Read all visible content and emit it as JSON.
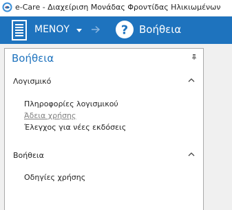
{
  "window": {
    "title": "e-Care - Διαχείριση Μονάδας Φροντίδας Ηλικιωμένων"
  },
  "toolbar": {
    "menu_label": "ΜΕΝΟΥ",
    "current_page": "Βοήθεια",
    "accent_color": "#1e73be"
  },
  "panel": {
    "title": "Βοήθεια",
    "sections": [
      {
        "header": "Λογισμικό",
        "items": [
          {
            "label": "Πληροφορίες λογισμικού"
          },
          {
            "label": "Άδεια χρήσης"
          },
          {
            "label": "Έλεγχος για νέες εκδόσεις"
          }
        ]
      },
      {
        "header": "Βοήθεια",
        "items": [
          {
            "label": "Οδηγίες χρήσης"
          }
        ]
      }
    ]
  }
}
